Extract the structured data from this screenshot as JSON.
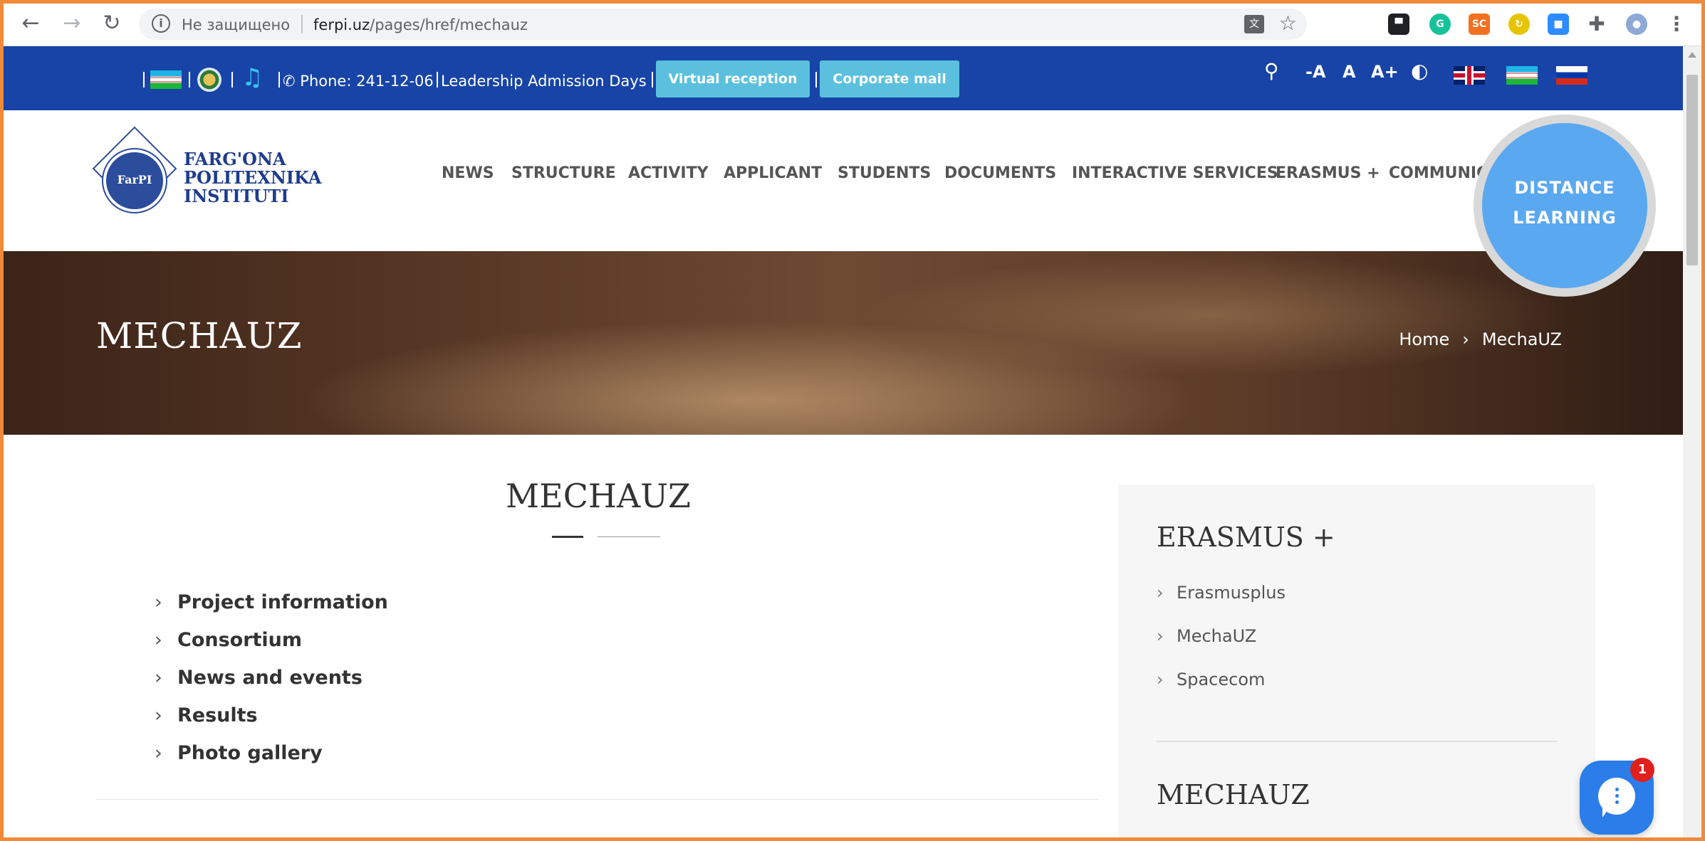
{
  "browser": {
    "insecure_label": "Не защищено",
    "url_host": "ferpi.uz",
    "url_path": "/pages/href/mechauz",
    "ext_sc": "SC"
  },
  "top_strip": {
    "phone": "Phone: 241-12-06",
    "leadership": "Leadership Admission Days",
    "virtual_reception": "Virtual reception",
    "corporate_mail": "Corporate mail",
    "text_smaller": "-A",
    "text_normal": "A",
    "text_larger": "A+"
  },
  "logo": {
    "line1": "FARG'ONA",
    "line2": "POLITEXNIKA",
    "line3": "INSTITUTI",
    "emblem_text": "FarPI"
  },
  "menu": {
    "news": "NEWS",
    "structure": "STRUCTURE",
    "activity": "ACTIVITY",
    "applicant": "APPLICANT",
    "students": "STUDENTS",
    "documents": "DOCUMENTS",
    "interactive": "INTERACTIVE SERVICES",
    "erasmus": "ERASMUS +",
    "communication": "COMMUNICATION"
  },
  "distance": {
    "line1": "DISTANCE",
    "line2": "LEARNING"
  },
  "banner": {
    "title": "MECHAUZ",
    "crumb_home": "Home",
    "crumb_sep": "›",
    "crumb_current": "MechaUZ"
  },
  "content": {
    "title": "MECHAUZ",
    "links": [
      "Project information",
      "Consortium",
      "News and events",
      "Results",
      "Photo gallery"
    ]
  },
  "sidebar": {
    "heading1": "ERASMUS +",
    "items": [
      "Erasmusplus",
      "MechaUZ",
      "Spacecom"
    ],
    "heading2": "MECHAUZ"
  },
  "chat": {
    "badge": "1"
  },
  "colors": {
    "frame": "#f08a38",
    "strip": "#1744a6",
    "button": "#5bc0de",
    "distance": "#5aa8f0",
    "chat": "#2b7de9"
  }
}
